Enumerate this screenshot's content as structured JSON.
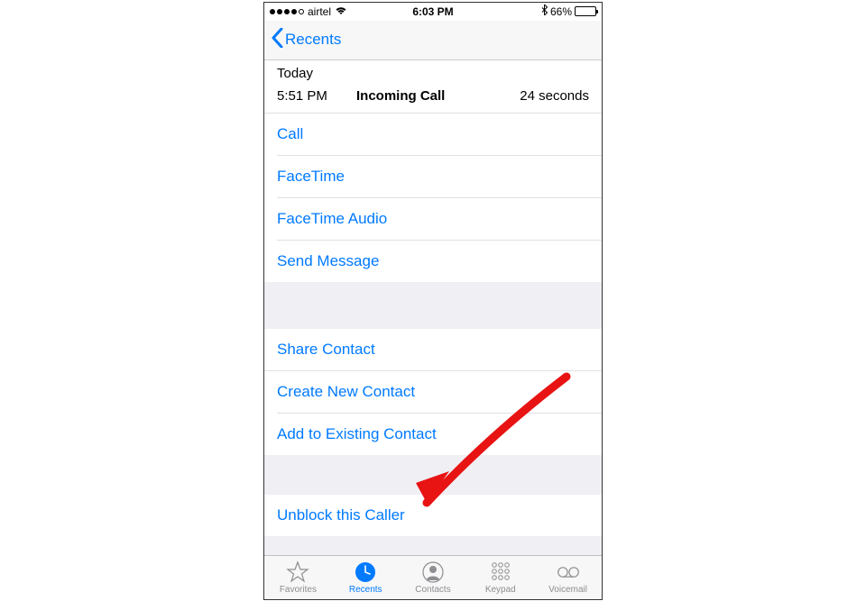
{
  "status": {
    "carrier": "airtel",
    "time": "6:03 PM",
    "battery_pct": "66%"
  },
  "nav": {
    "back_label": "Recents"
  },
  "call_log": {
    "day": "Today",
    "time": "5:51 PM",
    "type": "Incoming Call",
    "duration": "24 seconds"
  },
  "actions1": {
    "call": "Call",
    "facetime": "FaceTime",
    "facetime_audio": "FaceTime Audio",
    "send_message": "Send Message"
  },
  "actions2": {
    "share": "Share Contact",
    "create": "Create New Contact",
    "add": "Add to Existing Contact"
  },
  "actions3": {
    "unblock": "Unblock this Caller"
  },
  "tabs": {
    "favorites": "Favorites",
    "recents": "Recents",
    "contacts": "Contacts",
    "keypad": "Keypad",
    "voicemail": "Voicemail"
  }
}
